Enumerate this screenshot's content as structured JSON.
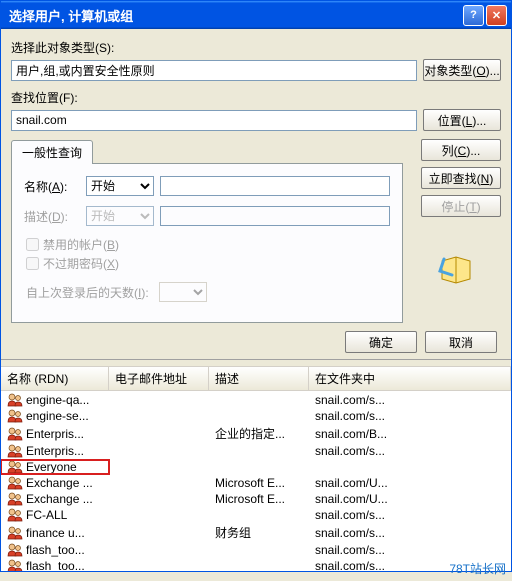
{
  "window": {
    "title": "选择用户, 计算机或组"
  },
  "labels": {
    "selectObjectType": "选择此对象类型(S):",
    "objectTypeValue": "用户,组,或内置安全性原则",
    "objectTypesBtn": "对象类型(O)...",
    "lookInLabel": "查找位置(F):",
    "lookInValue": "snail.com",
    "locationsBtn": "位置(L)...",
    "tabCommon": "一般性查询",
    "nameLabel": "名称(A):",
    "nameMode": "开始",
    "descLabel": "描述(D):",
    "descMode": "开始",
    "disabledAccounts": "禁用的帐户(B)",
    "nonExpiringPw": "不过期密码(X)",
    "daysSinceLogon": "自上次登录后的天数(I):",
    "columnsBtn": "列(C)...",
    "findNowBtn": "立即查找(N)",
    "stopBtn": "停止(T)",
    "okBtn": "确定",
    "cancelBtn": "取消"
  },
  "columns": {
    "name": "名称 (RDN)",
    "email": "电子邮件地址",
    "desc": "描述",
    "folder": "在文件夹中"
  },
  "rows": [
    {
      "name": "engine-qa...",
      "email": "",
      "desc": "",
      "folder": "snail.com/s..."
    },
    {
      "name": "engine-se...",
      "email": "",
      "desc": "",
      "folder": "snail.com/s..."
    },
    {
      "name": "Enterpris...",
      "email": "",
      "desc": "企业的指定...",
      "folder": "snail.com/B..."
    },
    {
      "name": "Enterpris...",
      "email": "",
      "desc": "",
      "folder": "snail.com/s..."
    },
    {
      "name": "Everyone",
      "email": "",
      "desc": "",
      "folder": "",
      "hl": true
    },
    {
      "name": "Exchange ...",
      "email": "",
      "desc": "Microsoft E...",
      "folder": "snail.com/U..."
    },
    {
      "name": "Exchange ...",
      "email": "",
      "desc": "Microsoft E...",
      "folder": "snail.com/U..."
    },
    {
      "name": "FC-ALL",
      "email": "",
      "desc": "",
      "folder": "snail.com/s..."
    },
    {
      "name": "finance u...",
      "email": "",
      "desc": "财务组",
      "folder": "snail.com/s..."
    },
    {
      "name": "flash_too...",
      "email": "",
      "desc": "",
      "folder": "snail.com/s..."
    },
    {
      "name": "flash_too...",
      "email": "",
      "desc": "",
      "folder": "snail.com/s..."
    }
  ],
  "watermark": "78T站长网"
}
